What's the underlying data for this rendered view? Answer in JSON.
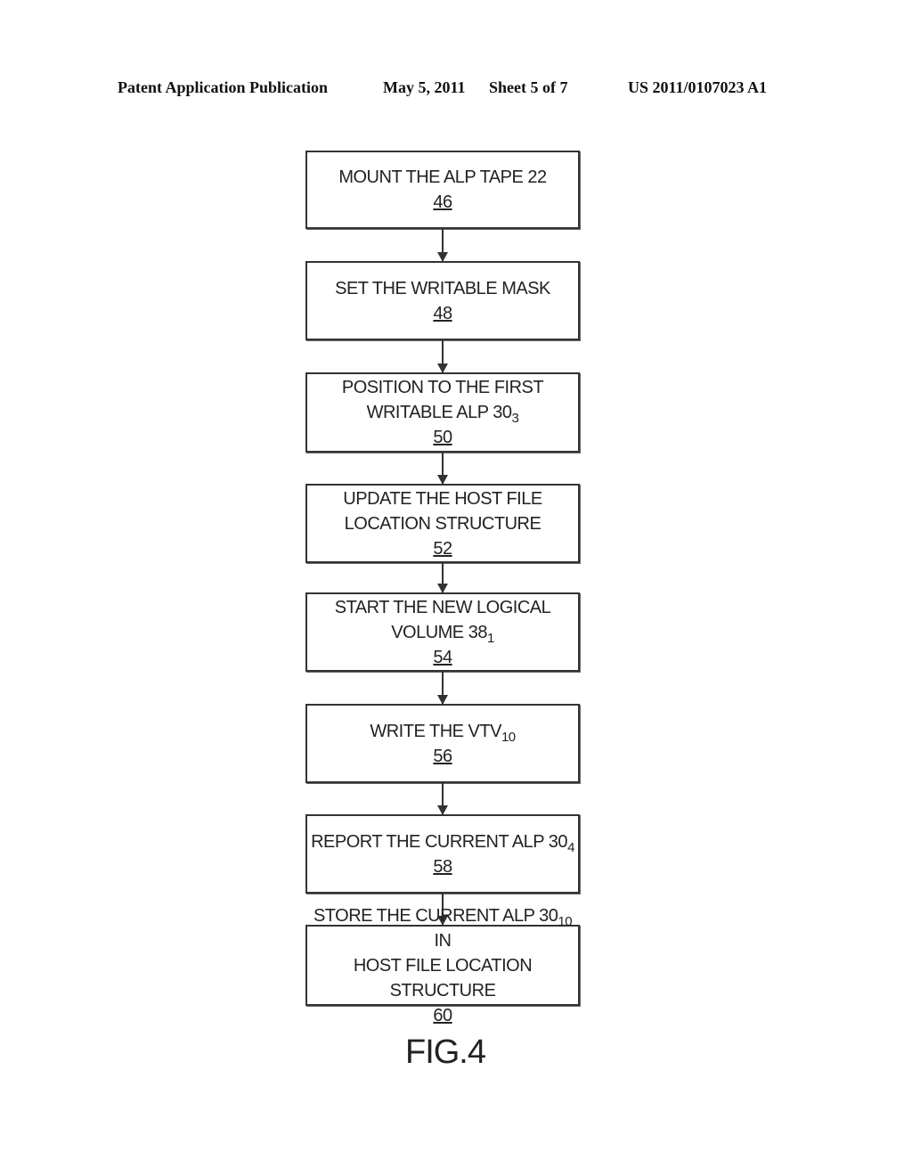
{
  "header": {
    "publication": "Patent Application Publication",
    "date": "May 5, 2011",
    "sheet": "Sheet 5 of 7",
    "number": "US 2011/0107023 A1"
  },
  "steps": [
    {
      "line1": "MOUNT THE ALP TAPE 22",
      "line2": "",
      "sub": "",
      "after": "",
      "ref": "46"
    },
    {
      "line1": "SET THE WRITABLE MASK",
      "line2": "",
      "sub": "",
      "after": "",
      "ref": "48"
    },
    {
      "line1": "POSITION TO THE FIRST",
      "line2": "WRITABLE ALP 30",
      "sub": "3",
      "after": "",
      "ref": "50"
    },
    {
      "line1": "UPDATE THE HOST FILE",
      "line2": "LOCATION STRUCTURE",
      "sub": "",
      "after": "",
      "ref": "52"
    },
    {
      "line1": "START THE NEW LOGICAL",
      "line2": "VOLUME 38",
      "sub": "1",
      "after": "",
      "ref": "54"
    },
    {
      "line1": "WRITE THE VTV",
      "line2": "",
      "sub": "10",
      "after": "",
      "ref": "56"
    },
    {
      "line1": "REPORT THE CURRENT ALP 30",
      "line2": "",
      "sub": "4",
      "after": "",
      "ref": "58"
    },
    {
      "line1": "STORE THE CURRENT ALP 30",
      "line2": "HOST FILE LOCATION STRUCTURE",
      "sub": "10",
      "after": " IN",
      "ref": "60"
    }
  ],
  "figure_label": "FIG.4"
}
